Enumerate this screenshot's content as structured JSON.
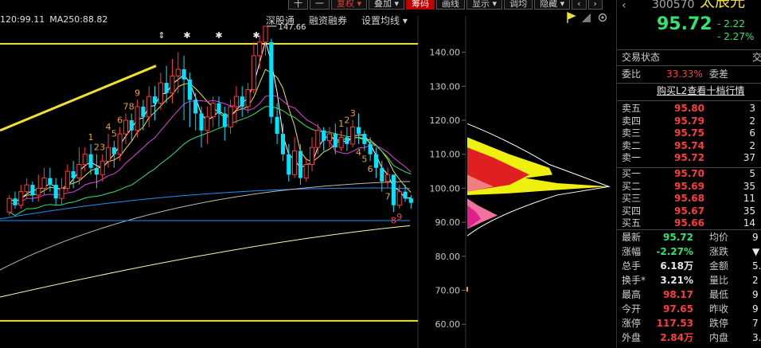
{
  "toolbar": {
    "buttons": [
      {
        "label": "十"
      },
      {
        "label": "一"
      },
      {
        "label": "复权 ▾"
      },
      {
        "label": "叠加 ▾"
      },
      {
        "label": "筹码"
      },
      {
        "label": "画线"
      },
      {
        "label": "显示 ▾"
      },
      {
        "label": "调均"
      },
      {
        "label": "隐藏 ▾"
      },
      {
        "label": "‹"
      },
      {
        "label": "›"
      }
    ]
  },
  "ma_legend": {
    "ma120": "120:99.11",
    "ma250": "MA250:88.82"
  },
  "top_links": {
    "link1": "深股通",
    "link2": "融资融券",
    "link3": "设置均线 ▾"
  },
  "y_axis": {
    "ticks": [
      "140.00",
      "130.00",
      "120.00",
      "110.00",
      "100.00",
      "90.00",
      "80.00",
      "70.00",
      "60.00"
    ]
  },
  "annotations": {
    "high_label": "147.66",
    "top_marks": [
      "⇕",
      "✱",
      "✱",
      "✱"
    ]
  },
  "chart_data": {
    "type": "candlestick",
    "y_range": [
      57,
      146
    ],
    "candles": [
      [
        93,
        97,
        92,
        98
      ],
      [
        97,
        95,
        94,
        99
      ],
      [
        95,
        99,
        94,
        101
      ],
      [
        99,
        101,
        97,
        103
      ],
      [
        101,
        98,
        96,
        102
      ],
      [
        98,
        100,
        96,
        104
      ],
      [
        100,
        103,
        98,
        106
      ],
      [
        103,
        101,
        99,
        106
      ],
      [
        101,
        97,
        95,
        103
      ],
      [
        97,
        100,
        95,
        103
      ],
      [
        100,
        105,
        99,
        107
      ],
      [
        105,
        103,
        100,
        108
      ],
      [
        103,
        107,
        101,
        112
      ],
      [
        107,
        110,
        105,
        112
      ],
      [
        110,
        106,
        104,
        113
      ],
      [
        106,
        104,
        100,
        110
      ],
      [
        104,
        108,
        102,
        110
      ],
      [
        108,
        112,
        106,
        116
      ],
      [
        112,
        110,
        106,
        114
      ],
      [
        110,
        116,
        108,
        118
      ],
      [
        116,
        120,
        113,
        122
      ],
      [
        120,
        117,
        114,
        122
      ],
      [
        117,
        124,
        115,
        126
      ],
      [
        124,
        121,
        117,
        126
      ],
      [
        121,
        127,
        118,
        130
      ],
      [
        127,
        125,
        120,
        130
      ],
      [
        125,
        131,
        123,
        134
      ],
      [
        131,
        128,
        125,
        136
      ],
      [
        128,
        133,
        125,
        138
      ],
      [
        133,
        135,
        128,
        140
      ],
      [
        135,
        132,
        120,
        139
      ],
      [
        132,
        126,
        118,
        134
      ],
      [
        126,
        122,
        117,
        128
      ],
      [
        122,
        117,
        112,
        124
      ],
      [
        117,
        121,
        113,
        124
      ],
      [
        121,
        125,
        118,
        127
      ],
      [
        125,
        122,
        118,
        127
      ],
      [
        122,
        118,
        114,
        124
      ],
      [
        118,
        124,
        116,
        126
      ],
      [
        124,
        127,
        119,
        130
      ],
      [
        127,
        124,
        121,
        130
      ],
      [
        124,
        129,
        122,
        131
      ],
      [
        129,
        139,
        128,
        143
      ],
      [
        139,
        143,
        135,
        145
      ],
      [
        143,
        147.66,
        139,
        147.66
      ],
      [
        143,
        121,
        119,
        144
      ],
      [
        121,
        116,
        113,
        125
      ],
      [
        116,
        110,
        108,
        119
      ],
      [
        110,
        104,
        102,
        113
      ],
      [
        104,
        111,
        103,
        115
      ],
      [
        111,
        103,
        101,
        113
      ],
      [
        103,
        107,
        102,
        109
      ],
      [
        107,
        112,
        105,
        115
      ],
      [
        112,
        117,
        110,
        119
      ],
      [
        117,
        114,
        111,
        118
      ],
      [
        114,
        116,
        112,
        118
      ],
      [
        116,
        112,
        110,
        119
      ],
      [
        112,
        115,
        111,
        117
      ],
      [
        115,
        113,
        111,
        118
      ],
      [
        113,
        118,
        112,
        120
      ],
      [
        118,
        116,
        113,
        122
      ],
      [
        116,
        113,
        111,
        117
      ],
      [
        113,
        110,
        108,
        115
      ],
      [
        110,
        106,
        103,
        112
      ],
      [
        106,
        102,
        99,
        108
      ],
      [
        102,
        104,
        100,
        106
      ],
      [
        104,
        95,
        93,
        104
      ],
      [
        95,
        99,
        94,
        101
      ],
      [
        99,
        97,
        96,
        101
      ],
      [
        97,
        95.72,
        94,
        98
      ]
    ],
    "td_labels": [
      {
        "i": 14,
        "text": "1",
        "color": "#f0a030"
      },
      {
        "i": 15,
        "text": "2",
        "color": "#f0a030"
      },
      {
        "i": 16,
        "text": "3",
        "color": "#f0a030"
      },
      {
        "i": 17,
        "text": "4",
        "color": "#f0a030"
      },
      {
        "i": 18,
        "text": "5",
        "color": "#f0a030"
      },
      {
        "i": 19,
        "text": "6",
        "color": "#f0a030"
      },
      {
        "i": 20,
        "text": "7",
        "color": "#f0a030"
      },
      {
        "i": 21,
        "text": "8",
        "color": "#f0a030"
      },
      {
        "i": 22,
        "text": "9",
        "color": "#f0a030"
      },
      {
        "i": 57,
        "text": "1",
        "color": "#f0a030"
      },
      {
        "i": 58,
        "text": "2",
        "color": "#f0a030"
      },
      {
        "i": 59,
        "text": "3",
        "color": "#f0a030"
      },
      {
        "i": 60,
        "text": "4",
        "color": "#f0a030"
      },
      {
        "i": 61,
        "text": "5",
        "color": "#f0a030"
      },
      {
        "i": 62,
        "text": "6",
        "color": "#f0a030"
      },
      {
        "i": 65,
        "text": "7",
        "color": "#f0a030"
      },
      {
        "i": 66,
        "text": "8",
        "color": "#ff4040"
      },
      {
        "i": 67,
        "text": "9",
        "color": "#ff4040"
      }
    ]
  },
  "stock": {
    "code": "300570",
    "name": "太辰光",
    "price": "95.72",
    "change": "- 2.22",
    "change_pct": "- 2.27%"
  },
  "trade_status": {
    "label": "交易状态",
    "right": "交"
  },
  "ratio": {
    "label1": "委比",
    "value1": "33.33%",
    "label2": "委差"
  },
  "l2_link": "购买L2查看十档行情",
  "asks": [
    {
      "label": "卖五",
      "price": "95.80",
      "vol": "3"
    },
    {
      "label": "卖四",
      "price": "95.79",
      "vol": "2"
    },
    {
      "label": "卖三",
      "price": "95.75",
      "vol": "6"
    },
    {
      "label": "卖二",
      "price": "95.74",
      "vol": "2"
    },
    {
      "label": "卖一",
      "price": "95.72",
      "vol": "37"
    }
  ],
  "bids": [
    {
      "label": "买一",
      "price": "95.70",
      "vol": "5"
    },
    {
      "label": "买二",
      "price": "95.69",
      "vol": "35"
    },
    {
      "label": "买三",
      "price": "95.68",
      "vol": "11"
    },
    {
      "label": "买四",
      "price": "95.67",
      "vol": "35"
    },
    {
      "label": "买五",
      "price": "95.66",
      "vol": "14"
    }
  ],
  "stats": [
    {
      "l1": "最新",
      "v1": "95.72",
      "c1": "green",
      "l2": "均价",
      "v2": "9"
    },
    {
      "l1": "涨幅",
      "v1": "-2.27%",
      "c1": "green",
      "l2": "涨跌",
      "v2": "▼"
    },
    {
      "l1": "总手",
      "v1": "6.18万",
      "c1": "white",
      "l2": "金额",
      "v2": "5."
    },
    {
      "l1": "换手*",
      "v1": "3.21%",
      "c1": "white",
      "l2": "量比",
      "v2": "2"
    },
    {
      "l1": "最高",
      "v1": "98.17",
      "c1": "red",
      "l2": "最低",
      "v2": "9"
    },
    {
      "l1": "今开",
      "v1": "97.65",
      "c1": "red",
      "l2": "昨收",
      "v2": "9"
    },
    {
      "l1": "涨停",
      "v1": "117.53",
      "c1": "red",
      "l2": "跌停",
      "v2": "7"
    },
    {
      "l1": "外盘",
      "v1": "2.84万",
      "c1": "red",
      "l2": "内盘",
      "v2": "3."
    }
  ],
  "colors": {
    "up": "#ff3c3c",
    "down": "#00e5ff",
    "accent": "#f0e030"
  }
}
